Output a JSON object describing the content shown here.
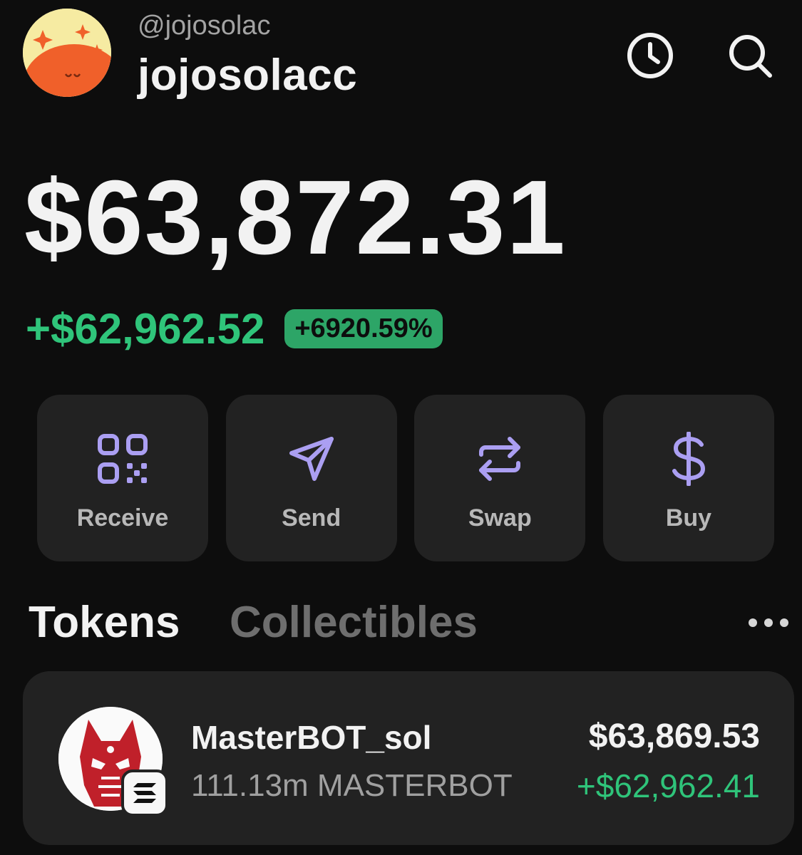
{
  "profile": {
    "handle": "@jojosolac",
    "username": "jojosolacc",
    "avatar_icon": "cartoon-avatar-icon"
  },
  "header_icons": {
    "history": "clock-icon",
    "search": "search-icon"
  },
  "portfolio": {
    "balance": "$63,872.31",
    "change_amount": "+$62,962.52",
    "change_percent": "+6920.59%"
  },
  "actions": [
    {
      "label": "Receive",
      "icon": "qr-code-icon"
    },
    {
      "label": "Send",
      "icon": "send-icon"
    },
    {
      "label": "Swap",
      "icon": "swap-icon"
    },
    {
      "label": "Buy",
      "icon": "dollar-icon"
    }
  ],
  "tabs": {
    "tokens": "Tokens",
    "collectibles": "Collectibles",
    "active": "Tokens"
  },
  "tokens": [
    {
      "name": "MasterBOT_sol",
      "amount": "111.13m MASTERBOT",
      "value": "$63,869.53",
      "change": "+$62,962.41",
      "logo_icon": "masterbot-logo-icon",
      "chain_icon": "solana-icon"
    }
  ],
  "colors": {
    "background": "#0d0d0d",
    "card": "#222222",
    "accent_purple": "#ab9ff2",
    "positive_green": "#2fc47a",
    "badge_green": "#2da567"
  }
}
